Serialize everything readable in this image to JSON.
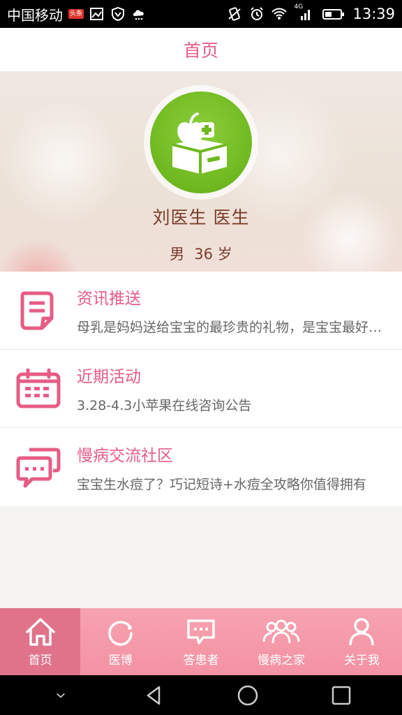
{
  "status_bar": {
    "carrier": "中国移动",
    "badge": "头条",
    "network": "4G",
    "time": "13:39",
    "icons": [
      "news-icon",
      "image-icon",
      "shield-icon",
      "cloud-icon",
      "vibrate-icon",
      "alarm-icon",
      "wifi-icon",
      "signal-icon",
      "battery-icon"
    ]
  },
  "header": {
    "title": "首页"
  },
  "profile": {
    "name": "刘医生 医生",
    "gender": "男",
    "age": "36 岁",
    "avatar_icon": "apple-medical-box-icon"
  },
  "list": [
    {
      "icon": "document-icon",
      "title": "资讯推送",
      "subtitle": "母乳是妈妈送给宝宝的最珍贵的礼物，是宝宝最好的食物"
    },
    {
      "icon": "calendar-icon",
      "title": "近期活动",
      "subtitle": "3.28-4.3小苹果在线咨询公告"
    },
    {
      "icon": "chat-icon",
      "title": "慢病交流社区",
      "subtitle": "宝宝生水痘了？巧记短诗+水痘全攻略你值得拥有"
    }
  ],
  "tabs": [
    {
      "label": "首页",
      "icon": "home-icon",
      "active": true
    },
    {
      "label": "医博",
      "icon": "refresh-icon",
      "active": false
    },
    {
      "label": "答患者",
      "icon": "message-icon",
      "active": false
    },
    {
      "label": "慢病之家",
      "icon": "group-icon",
      "active": false
    },
    {
      "label": "关于我",
      "icon": "user-icon",
      "active": false
    }
  ],
  "colors": {
    "accent": "#e65c84",
    "tab_bar": "#f392a3",
    "tab_active": "#e0738a",
    "avatar_green": "#6fb820",
    "name_text": "#7a3c2c"
  }
}
